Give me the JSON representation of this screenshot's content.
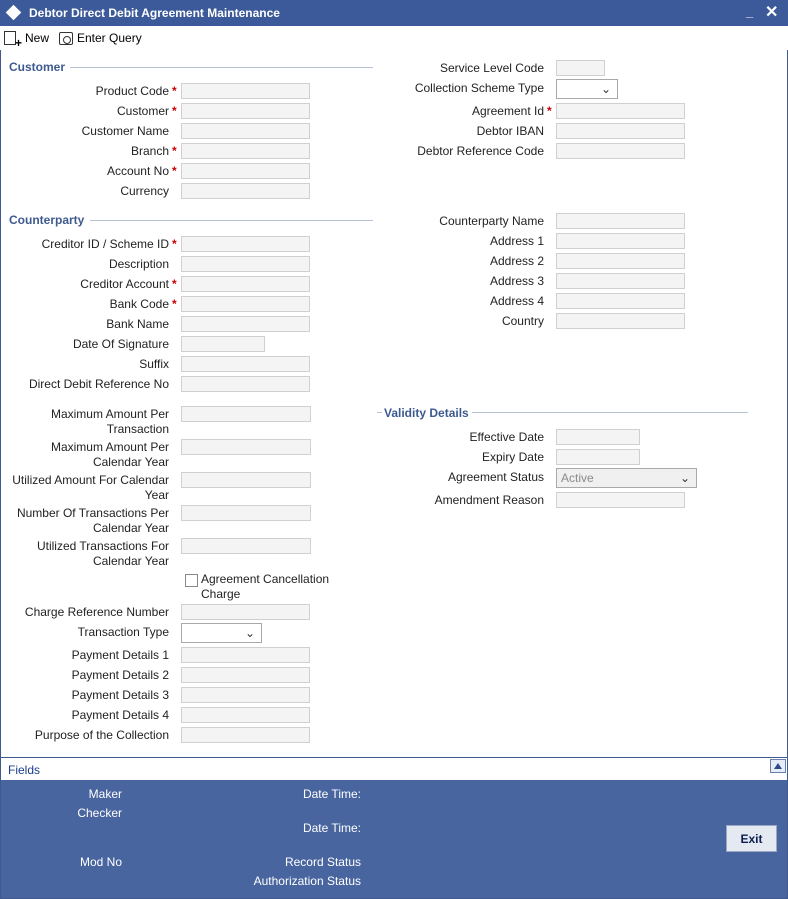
{
  "window": {
    "title": "Debtor Direct Debit Agreement Maintenance",
    "minimize": "_",
    "close": "✕"
  },
  "toolbar": {
    "new_label": "New",
    "enter_query_label": "Enter Query"
  },
  "sections": {
    "customer": "Customer",
    "counterparty": "Counterparty",
    "validity": "Validity Details"
  },
  "customer": {
    "product_code": "Product Code",
    "customer": "Customer",
    "customer_name": "Customer Name",
    "branch": "Branch",
    "account_no": "Account No",
    "currency": "Currency"
  },
  "right_top": {
    "service_level_code": "Service Level Code",
    "collection_scheme_type": "Collection Scheme Type",
    "agreement_id": "Agreement Id",
    "debtor_iban": "Debtor IBAN",
    "debtor_reference_code": "Debtor Reference Code"
  },
  "counterparty": {
    "creditor_id": "Creditor ID / Scheme ID",
    "description": "Description",
    "creditor_account": "Creditor Account",
    "bank_code": "Bank Code",
    "bank_name": "Bank Name",
    "date_of_signature": "Date Of Signature",
    "suffix": "Suffix",
    "dd_reference_no": "Direct Debit Reference No",
    "max_amt_txn_1": "Maximum Amount Per",
    "max_amt_txn_2": "Transaction",
    "max_amt_year_1": "Maximum Amount Per",
    "max_amt_year_2": "Calendar Year",
    "utilized_amt_1": "Utilized Amount For Calendar",
    "utilized_amt_2": "Year",
    "num_txn_1": "Number Of Transactions Per",
    "num_txn_2": "Calendar Year",
    "utilized_txn_1": "Utilized Transactions For",
    "utilized_txn_2": "Calendar Year",
    "cancellation_charge_1": "Agreement Cancellation",
    "cancellation_charge_2": "Charge",
    "charge_ref_no": "Charge Reference Number",
    "transaction_type": "Transaction Type",
    "payment_details_1": "Payment Details 1",
    "payment_details_2": "Payment Details 2",
    "payment_details_3": "Payment Details 3",
    "payment_details_4": "Payment Details 4",
    "purpose": "Purpose of the Collection"
  },
  "counterparty_right": {
    "name": "Counterparty Name",
    "address1": "Address 1",
    "address2": "Address 2",
    "address3": "Address 3",
    "address4": "Address 4",
    "country": "Country"
  },
  "validity": {
    "effective_date": "Effective Date",
    "expiry_date": "Expiry Date",
    "agreement_status": "Agreement Status",
    "agreement_status_value": "Active",
    "amendment_reason": "Amendment Reason"
  },
  "fields_bar": {
    "label": "Fields"
  },
  "footer": {
    "maker": "Maker",
    "checker": "Checker",
    "date_time_1": "Date Time:",
    "date_time_2": "Date Time:",
    "mod_no": "Mod No",
    "record_status": "Record Status",
    "authorization_status": "Authorization Status",
    "exit_label": "Exit"
  },
  "colors": {
    "title_bar": "#3c5a99",
    "footer": "#4865a0",
    "section_text": "#3e5a8f",
    "required": "#cc0000"
  }
}
